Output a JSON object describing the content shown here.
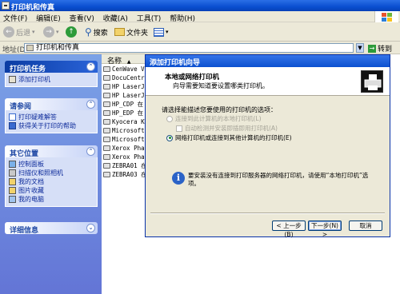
{
  "window": {
    "title": "打印机和传真"
  },
  "menu": [
    "文件(F)",
    "编辑(E)",
    "查看(V)",
    "收藏(A)",
    "工具(T)",
    "帮助(H)"
  ],
  "toolbar": {
    "back": "后退",
    "search": "搜索",
    "folders": "文件夹"
  },
  "address": {
    "label": "地址(D)",
    "value": "打印机和传真",
    "go": "转到"
  },
  "taskpane": {
    "printer_tasks": {
      "title": "打印机任务",
      "items": [
        "添加打印机"
      ]
    },
    "see_also": {
      "title": "请参阅",
      "items": [
        "打印疑难解答",
        "获得关于打印的帮助"
      ]
    },
    "other_places": {
      "title": "其它位置",
      "items": [
        "控制面板",
        "扫描仪和照相机",
        "我的文档",
        "图片收藏",
        "我的电脑"
      ]
    },
    "details": {
      "title": "详细信息"
    }
  },
  "filelist": {
    "column_name": "名称",
    "items": [
      "CenWave Vir",
      "DocuCentre-",
      "HP LaserJet",
      "HP LaserJet",
      "HP_CDP 在 j",
      "HP_EDP 在 j",
      "Kyocera KM-",
      "Microsoft O",
      "Microsoft O",
      "Xerox Phase",
      "Xerox Phase",
      "ZEBRA01 在",
      "ZEBRA03 在"
    ]
  },
  "wizard": {
    "title": "添加打印机向导",
    "heading": "本地或网络打印机",
    "subheading": "向导需要知道要设置哪类打印机。",
    "prompt": "请选择能描述您要使用的打印机的选项：",
    "option_local": "连接到此计算机的本地打印机(L)",
    "option_autodetect": "自动检测并安装即插即用打印机(A)",
    "option_network": "网络打印机或连接到其他计算机的打印机(E)",
    "info": "要安装没有连接到打印服务器的网络打印机，请使用“本地打印机”选项。",
    "back_button": "< 上一步(B)",
    "next_button": "下一步(N) >",
    "cancel_button": "取消"
  }
}
